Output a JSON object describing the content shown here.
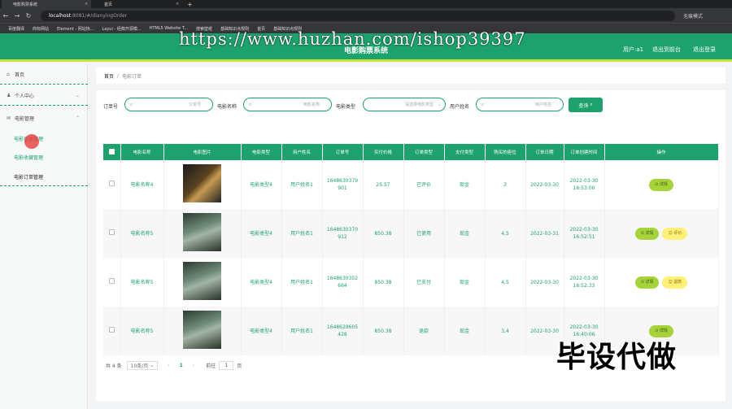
{
  "browser": {
    "tabs": [
      {
        "label": "电影购票系统"
      },
      {
        "label": "首页"
      }
    ],
    "url_host": "localhost",
    "url_path": ":8081/#/dianyingOrder",
    "profile": "无痕模式",
    "bookmarks": [
      "百度翻译",
      "商标网站",
      "Element - 网站快...",
      "Layui - 经典开源模...",
      "HTML5 Website T...",
      "搜索壁纸",
      "基础知识点规则",
      "首页",
      "基础知识点规则"
    ]
  },
  "header": {
    "title": "电影购票系统",
    "user": "用户:a1",
    "to_front": "退出到前台",
    "logout": "退出登录",
    "watermark": "https://www.huzhan.com/ishop39397"
  },
  "sidebar": {
    "home": "首页",
    "personal": "个人中心",
    "movie_mgmt": "电影管理",
    "sub_items": [
      "电影信息管理",
      "电影收藏管理",
      "电影订单管理"
    ]
  },
  "breadcrumb": {
    "home": "首页",
    "current": "电影订单"
  },
  "filters": [
    {
      "label": "订单号",
      "placeholder": "订单号"
    },
    {
      "label": "电影名称",
      "placeholder": "电影名称"
    },
    {
      "label": "电影类型",
      "placeholder": "请选择电影类型"
    },
    {
      "label": "用户姓名",
      "placeholder": "用户姓名"
    }
  ],
  "search_button": "查询",
  "table": {
    "headers": [
      "电影名称",
      "电影图片",
      "电影类型",
      "用户姓名",
      "订单号",
      "实付价格",
      "订单类型",
      "支付类型",
      "购买的座位",
      "订单日期",
      "订单创建时间",
      "操作"
    ],
    "rows": [
      {
        "name": "电影名称4",
        "type": "电影类型4",
        "user": "用户姓名1",
        "order": "1648630379901",
        "price": "25.57",
        "otype": "已评价",
        "pay": "现金",
        "seat": "3",
        "date": "2022-03-30",
        "created": "2022-03-30 16:53:00",
        "actions": [
          "详情"
        ]
      },
      {
        "name": "电影名称5",
        "type": "电影类型4",
        "user": "用户姓名1",
        "order": "1648630370912",
        "price": "850.38",
        "otype": "已使用",
        "pay": "现金",
        "seat": "4,5",
        "date": "2022-03-31",
        "created": "2022-03-30 16:52:51",
        "actions": [
          "详情",
          "评价"
        ]
      },
      {
        "name": "电影名称5",
        "type": "电影类型4",
        "user": "用户姓名1",
        "order": "1648630352664",
        "price": "850.38",
        "otype": "已支付",
        "pay": "现金",
        "seat": "4,5",
        "date": "2022-03-30",
        "created": "2022-03-30 16:52:33",
        "actions": [
          "详情",
          "退款"
        ]
      },
      {
        "name": "电影名称5",
        "type": "电影类型4",
        "user": "用户姓名1",
        "order": "1648629605428",
        "price": "850.38",
        "otype": "退款",
        "pay": "现金",
        "seat": "3,4",
        "date": "2022-03-30",
        "created": "2022-03-30 16:40:06",
        "actions": [
          "详情"
        ]
      }
    ]
  },
  "pager": {
    "total": "共 4 条",
    "size": "10条/页",
    "page": "1",
    "goto": "前往",
    "goto_value": "1",
    "unit": "页"
  },
  "overlay_text": "毕设代做"
}
